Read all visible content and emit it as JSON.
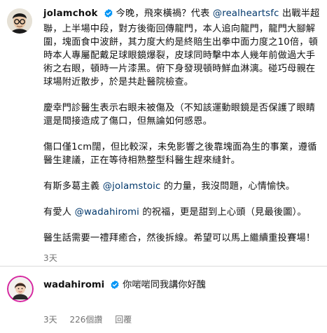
{
  "post": {
    "username": "jolamchok",
    "line1_pre": "今晚，飛來橫禍？代表 ",
    "line1_mention": "@realheartsfc",
    "line1_post": " 出戰半超聯，上半場中段，對方後衛回傳龍門，本人追向龍門，龍門大腳解圍，塊面食中波餅，其力度大約是終賠生出拳中面力度之10倍，頓時本人專屬配戴足球眼鏡爆裂，皮球同時擊中本人幾年前做過大手術之右眼，頓時一片漆黑。俯下身發現頓時鮮血淋漓。碰巧母親在球場附近散步，於是共赴醫院檢查。",
    "para2": "慶幸門診醫生表示右眼未被傷及（不知該運動眼鏡是否保護了眼睛還是間接造成了傷口，但無論如何感恩。",
    "para3": "傷口僅1cm闊，但比較深，未免影響之後靠塊面為生的事業，遵循醫生建議，正在等待相熟整型科醫生趕來縫針。",
    "para4_pre": "有斯多葛主義 ",
    "para4_mention": "@jolamstoic",
    "para4_post": " 的力量，我沒問題，心情愉快。",
    "para5_pre": "有愛人 ",
    "para5_mention": "@wadahiromi",
    "para5_post": " 的祝福，更是甜到上心頭（見最後圖）。",
    "para6": "醫生話需要一禮拜癒合，然後拆線。希望可以馬上繼續重投賽場！",
    "time": "3天"
  },
  "comment": {
    "username": "wadahiromi",
    "text": "你啱啱同我講你好醜",
    "time": "3天",
    "likes": "226個讚",
    "reply": "回覆"
  },
  "colors": {
    "verified": "#0095f6",
    "mention": "#00376b",
    "meta": "#737373"
  }
}
